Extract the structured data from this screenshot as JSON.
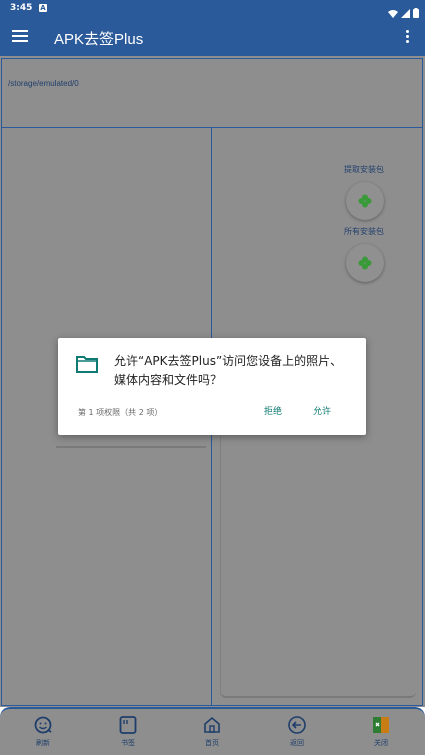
{
  "status_bar": {
    "time": "3:45",
    "notif_letter": "A"
  },
  "app_bar": {
    "title": "APK去签Plus"
  },
  "path": {
    "text": "/storage/emulated/0"
  },
  "floating": {
    "extract_label": "提取安装包",
    "all_label": "所有安装包",
    "accent": "#3a9a3a"
  },
  "dialog": {
    "message": "允许“APK去签Plus”访问您设备上的照片、媒体内容和文件吗？",
    "count": "第 1 项权限（共 2 项）",
    "deny": "拒绝",
    "allow": "允许",
    "accent": "#0f7a72"
  },
  "bottom_nav": [
    {
      "label": "刷新",
      "icon": "refresh-icon"
    },
    {
      "label": "书签",
      "icon": "bookmark-icon"
    },
    {
      "label": "首页",
      "icon": "home-icon"
    },
    {
      "label": "返回",
      "icon": "back-icon"
    },
    {
      "label": "关闭",
      "icon": "close-app-icon"
    }
  ],
  "colors": {
    "primary": "#2b5a9a",
    "scrim": "#8e8e8e"
  }
}
